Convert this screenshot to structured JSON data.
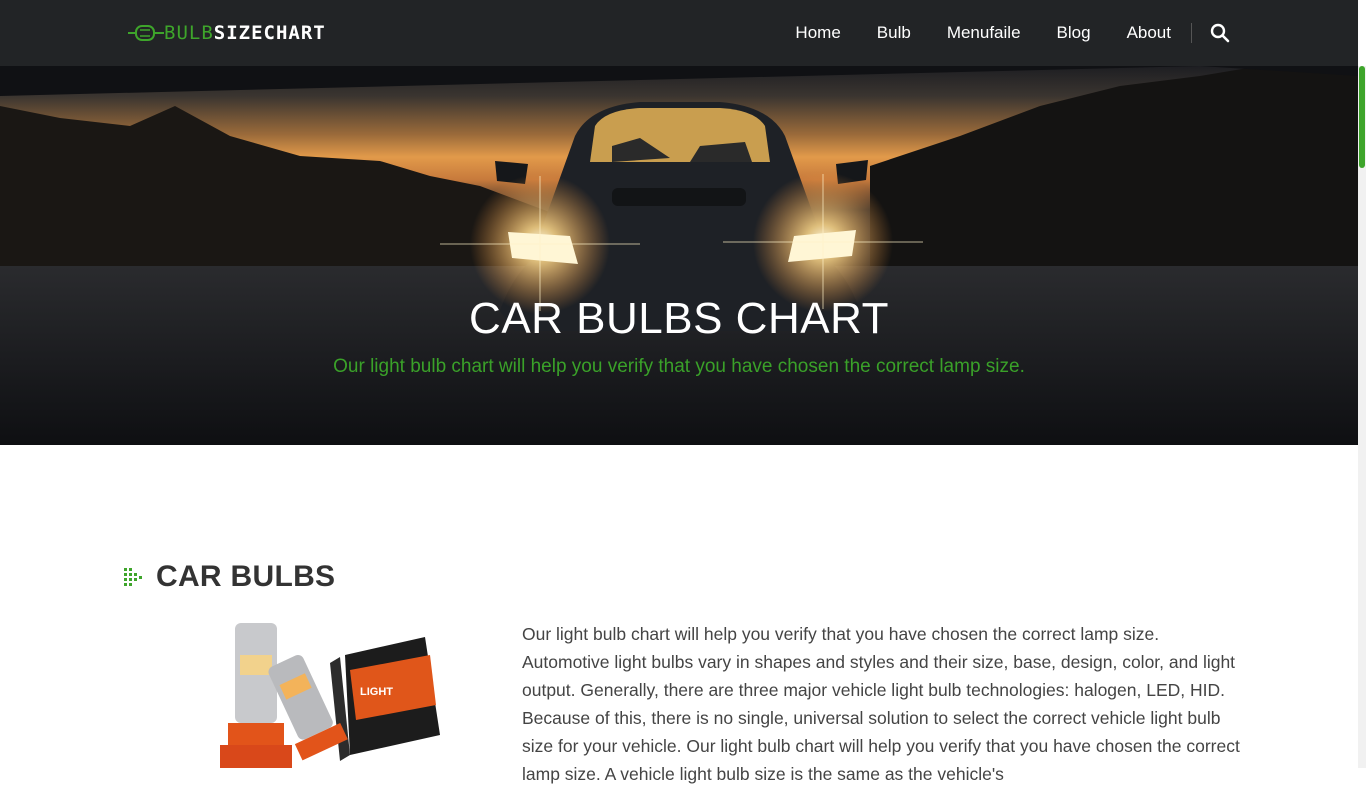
{
  "header": {
    "logo_left": "BULB",
    "logo_right": "SIZECHART",
    "nav": [
      "Home",
      "Bulb",
      "Menufaile",
      "Blog",
      "About"
    ]
  },
  "hero": {
    "title": "CAR BULBS CHART",
    "subtitle": "Our light bulb chart will help you verify that you have chosen the correct lamp size."
  },
  "section": {
    "heading": "CAR BULBS",
    "body": "Our light bulb chart will help you verify that you have chosen the correct lamp size. Automotive light bulbs vary in shapes and styles and their size, base, design, color, and light output. Generally, there are three major vehicle light bulb technologies: halogen, LED, HID. Because of this, there is no single, universal solution to select the correct vehicle light bulb size for your vehicle. Our light bulb chart will help you verify that you have chosen the correct lamp size. A vehicle light bulb size is the same as the vehicle's",
    "product_box_text": "LIGHT"
  },
  "colors": {
    "brand_green": "#3ea52b",
    "header_bg": "#222426"
  },
  "icons": [
    "bulb-logo-icon",
    "search-icon",
    "arrow-bullet-icon"
  ]
}
